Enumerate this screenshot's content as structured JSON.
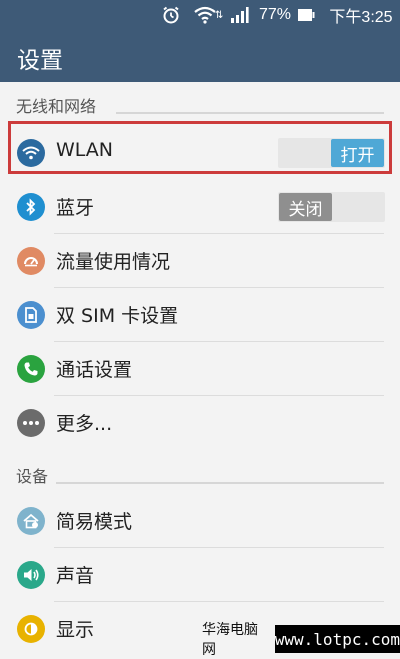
{
  "status_bar": {
    "battery": "77%",
    "time": "下午3:25"
  },
  "app_bar": {
    "title": "设置"
  },
  "sections": [
    {
      "title": "无线和网络",
      "items": [
        {
          "label": "WLAN",
          "toggle": "打开",
          "icon": "wifi-icon",
          "icon_color": "#2b6a9f"
        },
        {
          "label": "蓝牙",
          "toggle": "关闭",
          "icon": "bluetooth-icon",
          "icon_color": "#1f8fd0"
        },
        {
          "label": "流量使用情况",
          "icon": "data-usage-icon",
          "icon_color": "#e08a63"
        },
        {
          "label": "双 SIM 卡设置",
          "icon": "sim-card-icon",
          "icon_color": "#4b8fcf"
        },
        {
          "label": "通话设置",
          "icon": "phone-icon",
          "icon_color": "#2aa33f"
        },
        {
          "label": "更多...",
          "icon": "more-icon",
          "icon_color": "#6b6b6b"
        }
      ]
    },
    {
      "title": "设备",
      "items": [
        {
          "label": "简易模式",
          "icon": "easy-mode-icon",
          "icon_color": "#7fb3cc"
        },
        {
          "label": "声音",
          "icon": "sound-icon",
          "icon_color": "#2aa88a"
        },
        {
          "label": "显示",
          "icon": "display-icon",
          "icon_color": "#e8b200"
        }
      ]
    }
  ],
  "watermark": {
    "text": "华海电脑网",
    "url": "www.lotpc.com"
  },
  "colors": {
    "app_bar": "#3e5a77",
    "toggle_on": "#4fa8d6",
    "toggle_off": "#8f8f8f",
    "highlight": "#cc3b3b"
  }
}
